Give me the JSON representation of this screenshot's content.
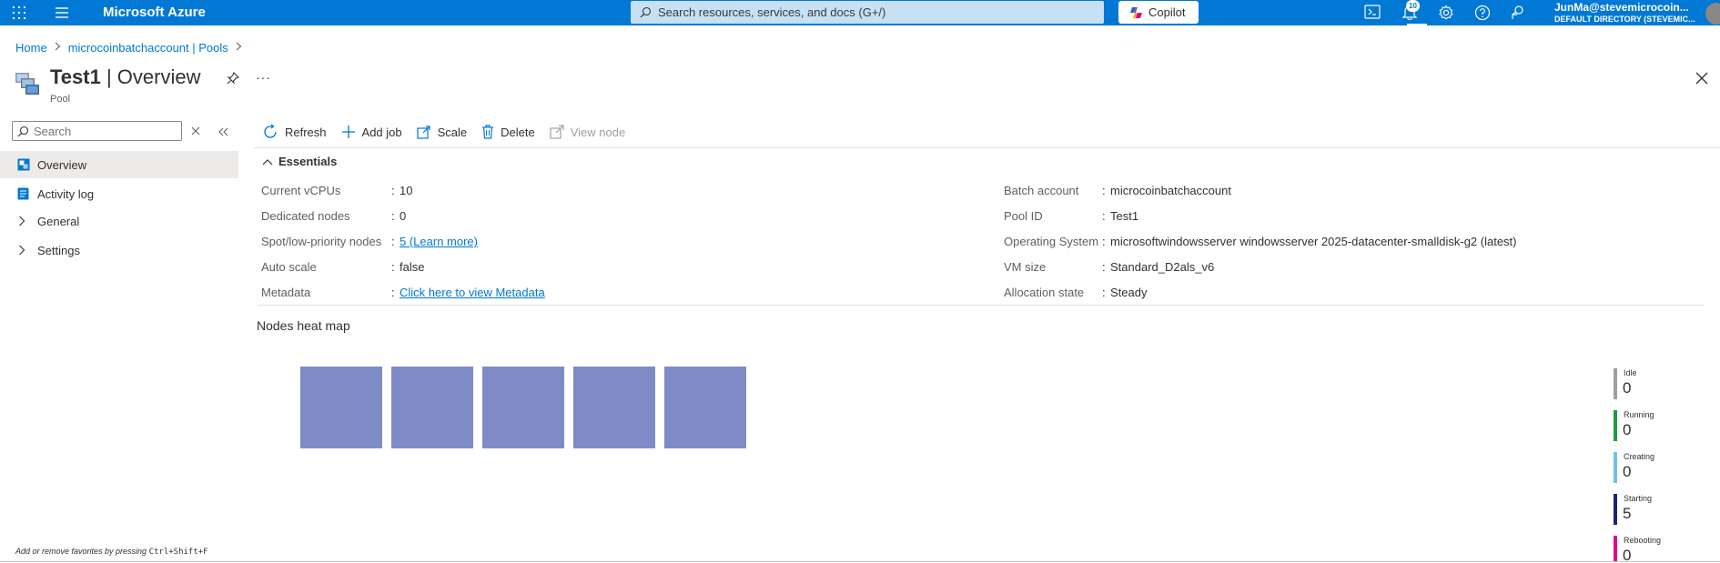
{
  "topbar": {
    "brand": "Microsoft Azure",
    "search_placeholder": "Search resources, services, and docs (G+/)",
    "copilot_label": "Copilot",
    "notification_count": "10",
    "user_name": "JunMa@stevemicrocoin...",
    "user_directory": "DEFAULT DIRECTORY (STEVEMIC..."
  },
  "breadcrumb": {
    "home": "Home",
    "parent": "microcoinbatchaccount | Pools"
  },
  "header": {
    "title_bold": "Test1",
    "title_rest": " | Overview",
    "subtitle": "Pool",
    "more": "···"
  },
  "sidebar": {
    "search_placeholder": "Search",
    "items": [
      {
        "label": "Overview",
        "icon": "overview-icon",
        "active": true
      },
      {
        "label": "Activity log",
        "icon": "activity-log-icon",
        "active": false
      },
      {
        "label": "General",
        "icon": "chevron-right-icon",
        "active": false
      },
      {
        "label": "Settings",
        "icon": "chevron-right-icon",
        "active": false
      }
    ],
    "footer_prefix": "Add or remove favorites by pressing ",
    "footer_shortcut": "Ctrl+Shift+F"
  },
  "toolbar": {
    "refresh": "Refresh",
    "add_job": "Add job",
    "scale": "Scale",
    "delete": "Delete",
    "view_node": "View node"
  },
  "essentials": {
    "heading": "Essentials",
    "colon": ":",
    "left": [
      {
        "label": "Current vCPUs",
        "value": "10"
      },
      {
        "label": "Dedicated nodes",
        "value": "0"
      },
      {
        "label": "Spot/low-priority nodes",
        "value": "5 (Learn more)"
      },
      {
        "label": "Auto scale",
        "value": "false"
      },
      {
        "label": "Metadata",
        "value": "Click here to view Metadata"
      }
    ],
    "right": [
      {
        "label": "Batch account",
        "value": "microcoinbatchaccount"
      },
      {
        "label": "Pool ID",
        "value": "Test1"
      },
      {
        "label": "Operating System",
        "value": "microsoftwindowsserver windowsserver 2025-datacenter-smalldisk-g2 (latest)"
      },
      {
        "label": "VM size",
        "value": "Standard_D2als_v6"
      },
      {
        "label": "Allocation state",
        "value": "Steady"
      }
    ]
  },
  "heatmap": {
    "title": "Nodes heat map",
    "node_count": 5,
    "node_color": "#7f8bc7",
    "legend": [
      {
        "label": "Idle",
        "count": "0",
        "color": "#a19f9d"
      },
      {
        "label": "Running",
        "count": "0",
        "color": "#1a9e3f"
      },
      {
        "label": "Creating",
        "count": "0",
        "color": "#6ec2e8"
      },
      {
        "label": "Starting",
        "count": "5",
        "color": "#1a237e"
      },
      {
        "label": "Rebooting",
        "count": "0",
        "color": "#e3008c"
      }
    ]
  },
  "colors": {
    "azure_blue": "#0078d4",
    "link": "#0078d4"
  }
}
